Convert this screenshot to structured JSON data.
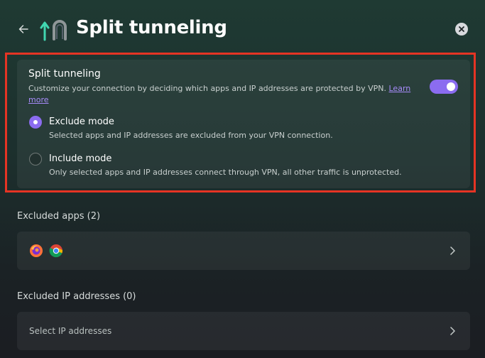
{
  "header": {
    "title": "Split tunneling",
    "back_icon": "arrow-left-icon",
    "close_icon": "close-icon"
  },
  "split_tunneling": {
    "title": "Split tunneling",
    "description": "Customize your connection by deciding which apps and IP addresses are protected by VPN.",
    "learn_more": "Learn more",
    "enabled": true
  },
  "modes": [
    {
      "title": "Exclude mode",
      "description": "Selected apps and IP addresses are excluded from your VPN connection.",
      "selected": true
    },
    {
      "title": "Include mode",
      "description": "Only selected apps and IP addresses connect through VPN, all other traffic is unprotected.",
      "selected": false
    }
  ],
  "excluded_apps": {
    "label": "Excluded apps (2)",
    "apps": [
      "firefox-icon",
      "chrome-icon"
    ]
  },
  "excluded_ips": {
    "label": "Excluded IP addresses (0)",
    "placeholder": "Select IP addresses"
  },
  "colors": {
    "accent": "#8b6cf0",
    "highlight_border": "#e53424",
    "link": "#a78bfa"
  }
}
